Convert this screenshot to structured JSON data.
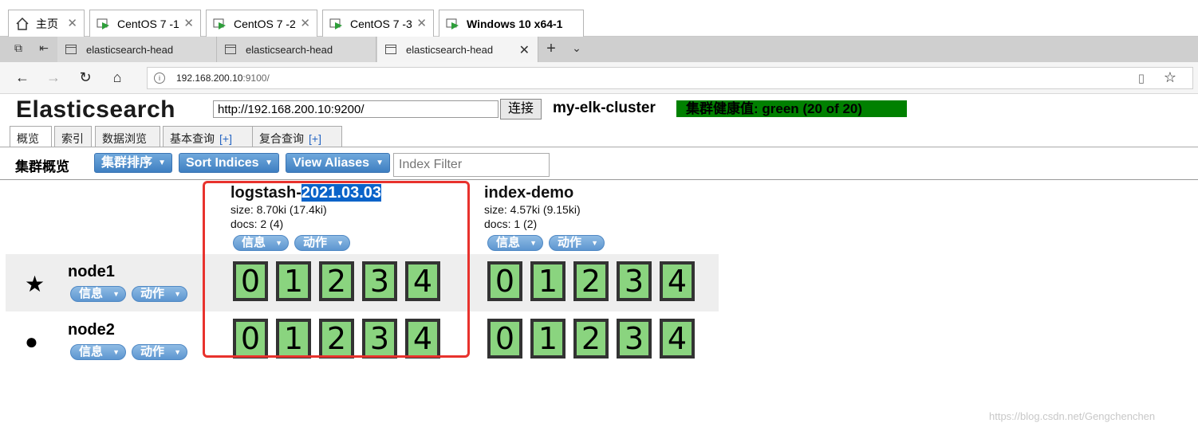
{
  "vm_tabs": [
    {
      "label": "主页",
      "icon": "home-icon"
    },
    {
      "label": "CentOS 7 -1",
      "icon": "vm-icon"
    },
    {
      "label": "CentOS 7 -2",
      "icon": "vm-icon"
    },
    {
      "label": "CentOS 7 -3",
      "icon": "vm-icon"
    },
    {
      "label": "Windows 10 x64-1",
      "icon": "vm-icon"
    }
  ],
  "browser_tabs": [
    "elasticsearch-head",
    "elasticsearch-head",
    "elasticsearch-head"
  ],
  "address": {
    "host": "192.168.200.10",
    "port": ":9100/"
  },
  "header": {
    "title": "Elasticsearch",
    "url_value": "http://192.168.200.10:9200/",
    "connect_label": "连接",
    "cluster_name": "my-elk-cluster",
    "health": "集群健康值: green (20 of 20)",
    "health_color": "#008000"
  },
  "app_tabs": [
    "概览",
    "索引",
    "数据浏览",
    "基本查询",
    "[+]",
    "复合查询",
    "[+]"
  ],
  "toolbar": {
    "label": "集群概览",
    "sort_cluster": "集群排序",
    "sort_indices": "Sort Indices",
    "view_aliases": "View Aliases",
    "filter_placeholder": "Index Filter"
  },
  "indices": [
    {
      "name_prefix": "logstash-",
      "name_highlight": "2021.03.03",
      "size": "size: 8.70ki (17.4ki)",
      "docs": "docs: 2 (4)",
      "info": "信息",
      "action": "动作"
    },
    {
      "name_prefix": "index-demo",
      "name_highlight": "",
      "size": "size: 4.57ki (9.15ki)",
      "docs": "docs: 1 (2)",
      "info": "信息",
      "action": "动作"
    }
  ],
  "nodes": [
    {
      "name": "node1",
      "icon": "star-icon",
      "info": "信息",
      "action": "动作"
    },
    {
      "name": "node2",
      "icon": "circle-icon",
      "info": "信息",
      "action": "动作"
    }
  ],
  "shards": [
    "0",
    "1",
    "2",
    "3",
    "4"
  ],
  "shard_color": "#8ad47f",
  "watermark": "https://blog.csdn.net/Gengchenchen"
}
